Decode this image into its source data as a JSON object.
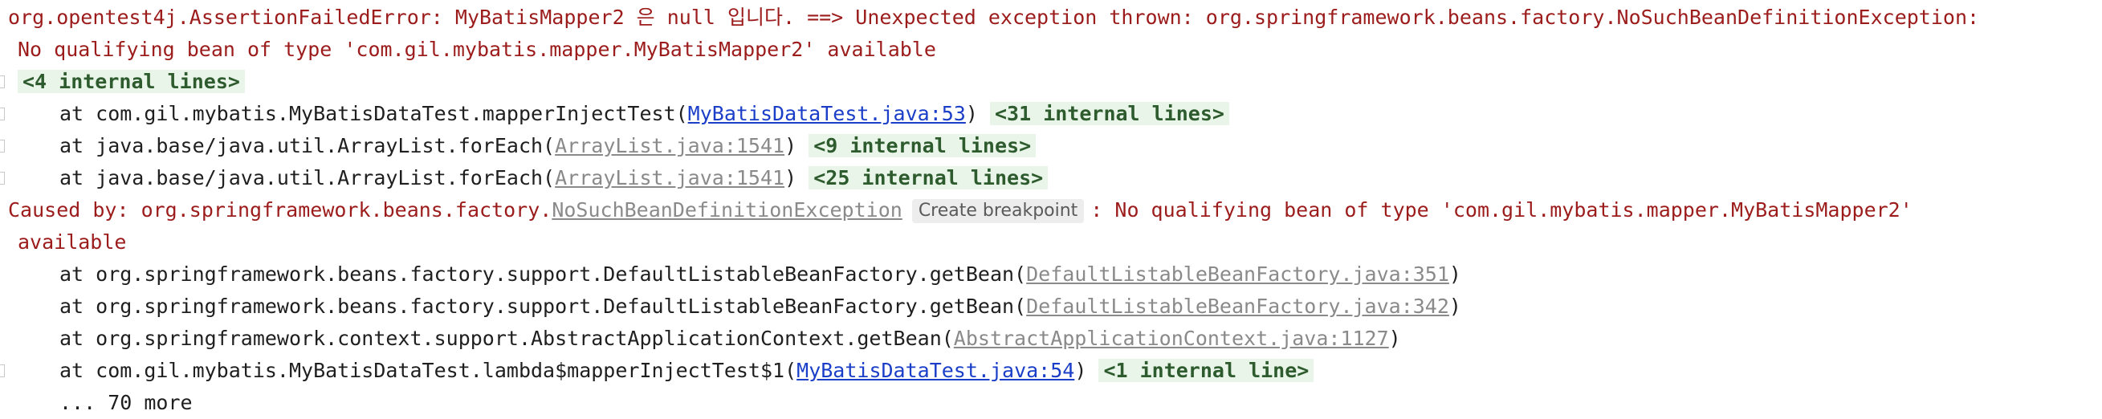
{
  "console": {
    "line1": {
      "text": "org.opentest4j.AssertionFailedError: MyBatisMapper2 은 null 입니다. ==> Unexpected exception thrown: org.springframework.beans.factory.NoSuchBeanDefinitionException:"
    },
    "line2": {
      "text": "No qualifying bean of type 'com.gil.mybatis.mapper.MyBatisMapper2' available"
    },
    "line3": {
      "internal": "<4 internal lines>"
    },
    "line4": {
      "prefix": "at com.gil.mybatis.MyBatisDataTest.mapperInjectTest(",
      "link": "MyBatisDataTest.java:53",
      "suffix": ")",
      "internal": "<31 internal lines>"
    },
    "line5": {
      "prefix": "at java.base/java.util.ArrayList.forEach(",
      "link": "ArrayList.java:1541",
      "suffix": ")",
      "internal": "<9 internal lines>"
    },
    "line6": {
      "prefix": "at java.base/java.util.ArrayList.forEach(",
      "link": "ArrayList.java:1541",
      "suffix": ")",
      "internal": "<25 internal lines>"
    },
    "line7": {
      "prefix": "Caused by: org.springframework.beans.factory.",
      "link": "NoSuchBeanDefinitionException",
      "breakpoint": "Create breakpoint",
      "suffix": ": No qualifying bean of type 'com.gil.mybatis.mapper.MyBatisMapper2'"
    },
    "line8": {
      "text": "available"
    },
    "line9": {
      "prefix": "at org.springframework.beans.factory.support.DefaultListableBeanFactory.getBean(",
      "link": "DefaultListableBeanFactory.java:351",
      "suffix": ")"
    },
    "line10": {
      "prefix": "at org.springframework.beans.factory.support.DefaultListableBeanFactory.getBean(",
      "link": "DefaultListableBeanFactory.java:342",
      "suffix": ")"
    },
    "line11": {
      "prefix": "at org.springframework.context.support.AbstractApplicationContext.getBean(",
      "link": "AbstractApplicationContext.java:1127",
      "suffix": ")"
    },
    "line12": {
      "prefix": "at com.gil.mybatis.MyBatisDataTest.lambda$mapperInjectTest$1(",
      "link": "MyBatisDataTest.java:54",
      "suffix": ")",
      "internal": "<1 internal line>"
    },
    "line13": {
      "text": "... 70 more"
    }
  },
  "colors": {
    "error_text": "#9c1c1c",
    "link_primary": "#1a3ec8",
    "link_muted": "#8a8a8a",
    "internal_bg": "#e9f5e9"
  }
}
